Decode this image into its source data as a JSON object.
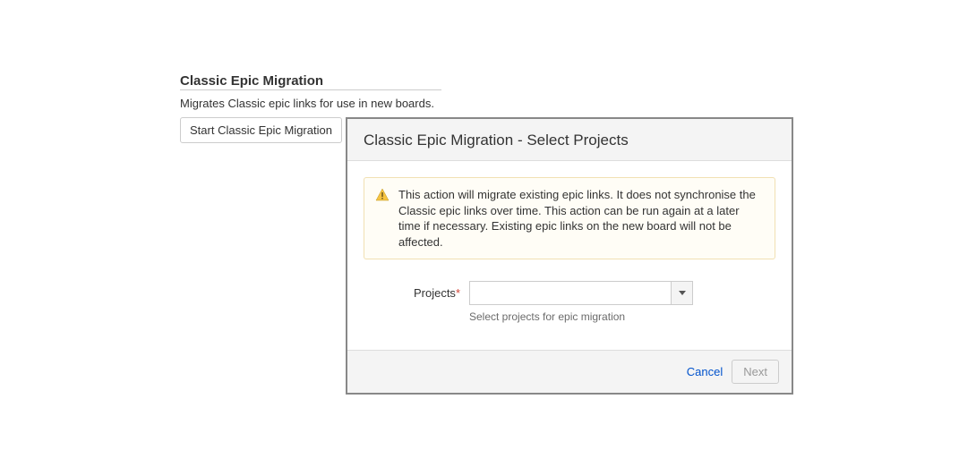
{
  "section": {
    "title": "Classic Epic Migration",
    "description": "Migrates Classic epic links for use in new boards.",
    "start_button_label": "Start Classic Epic Migration"
  },
  "dialog": {
    "title": "Classic Epic Migration - Select Projects",
    "warning": "This action will migrate existing epic links. It does not synchronise the Classic epic links over time. This action can be run again at a later time if necessary. Existing epic links on the new board will not be affected.",
    "form": {
      "projects_label": "Projects",
      "projects_value": "",
      "projects_hint": "Select projects for epic migration"
    },
    "footer": {
      "cancel_label": "Cancel",
      "next_label": "Next"
    }
  }
}
